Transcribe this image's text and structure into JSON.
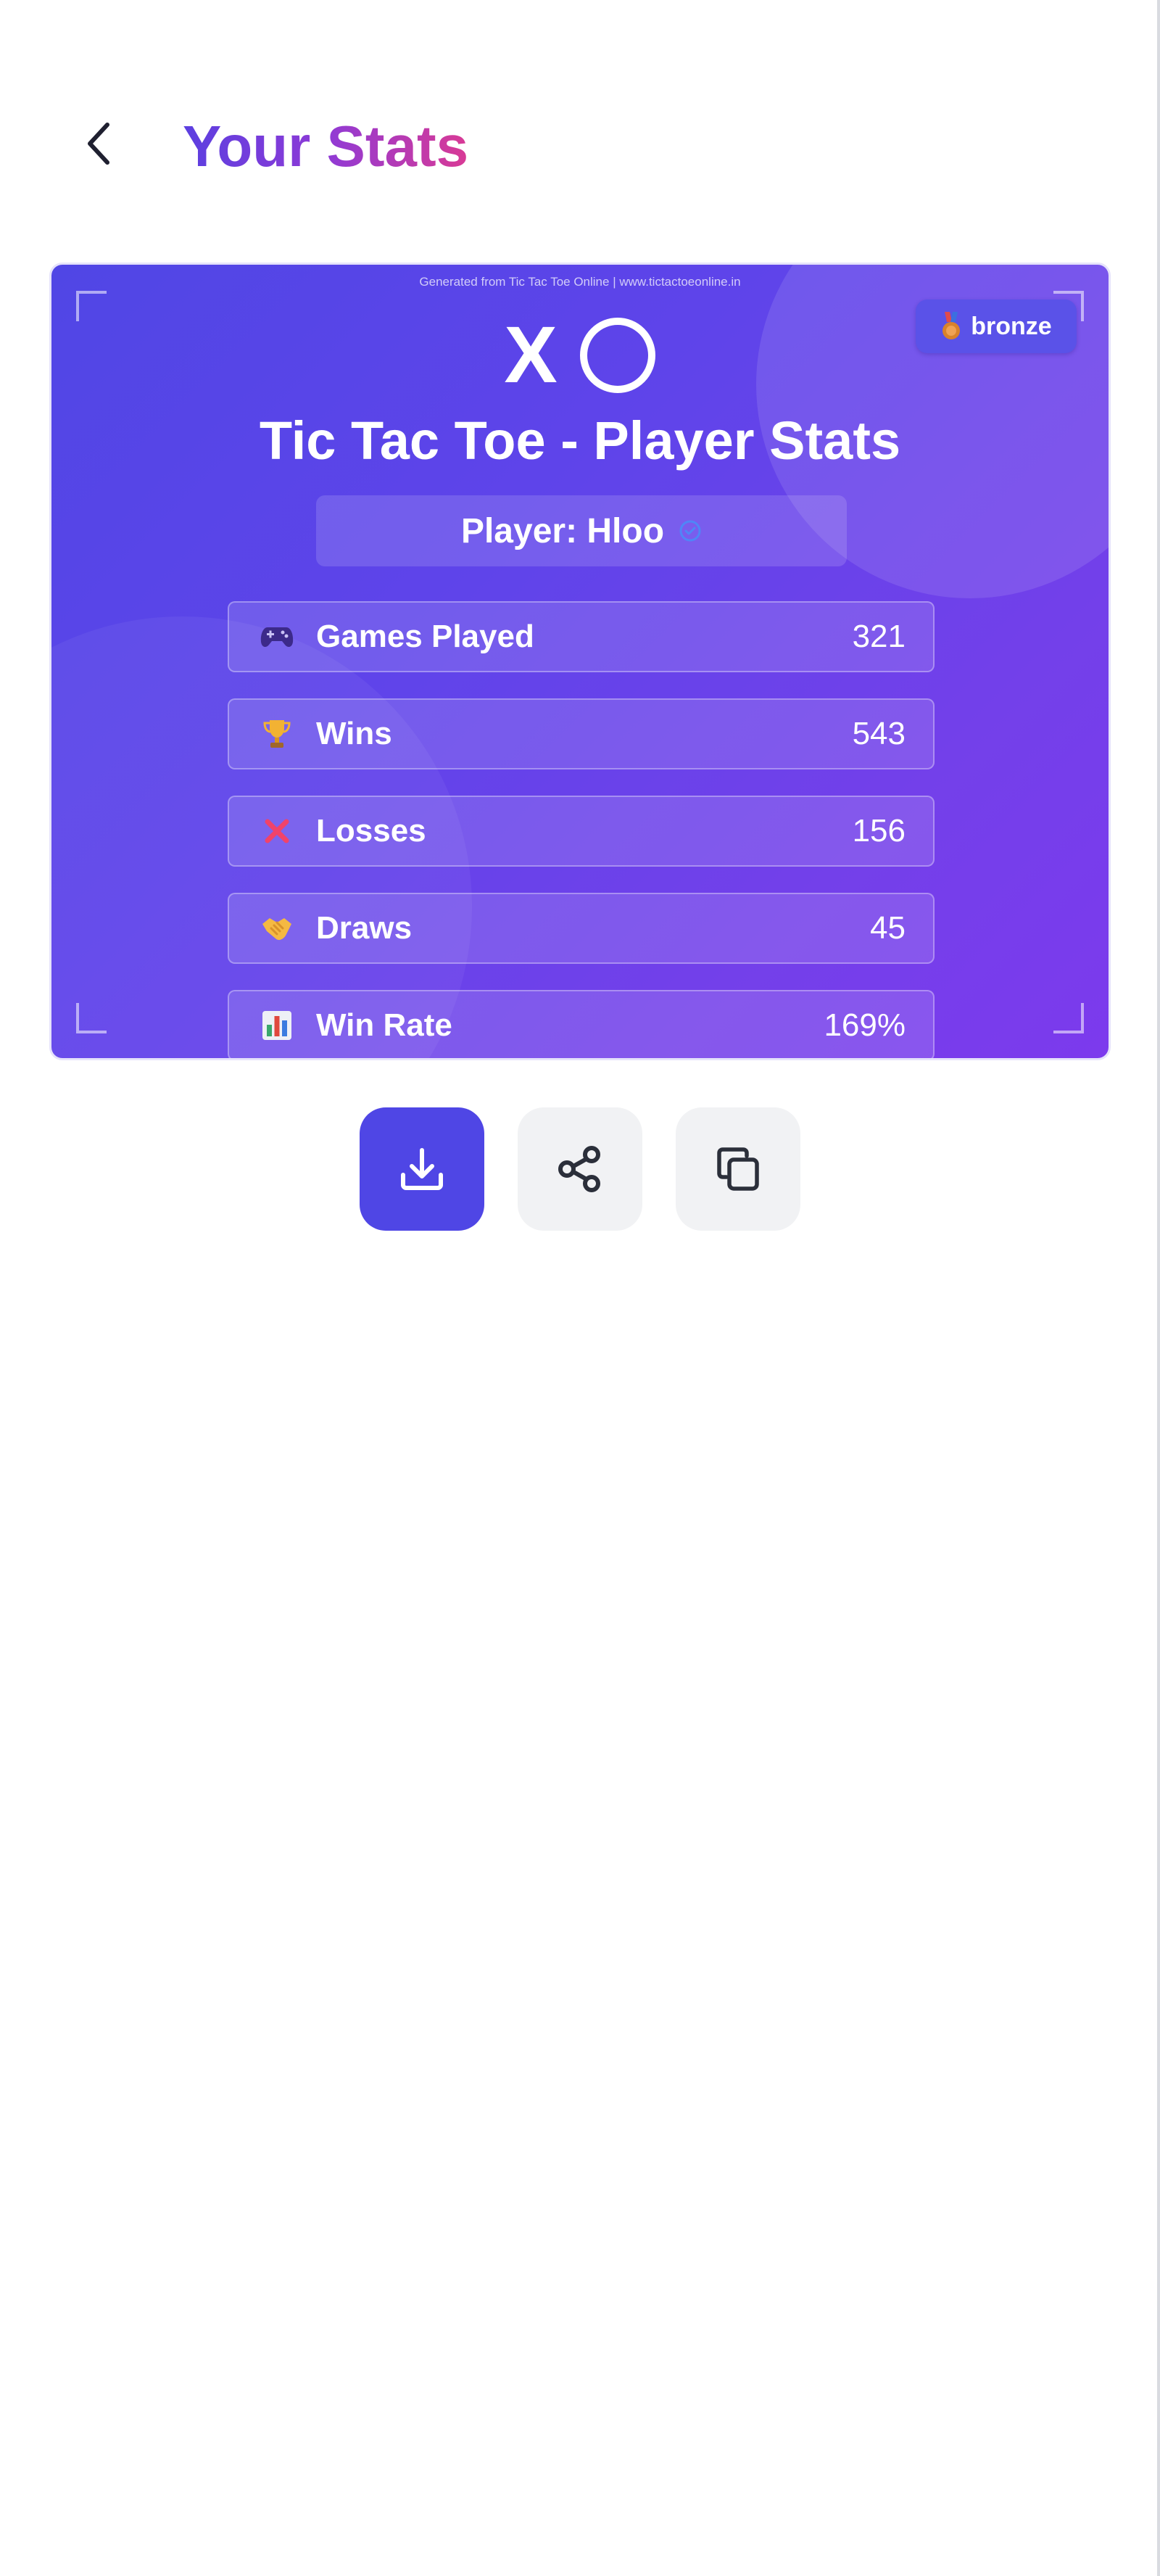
{
  "header": {
    "title": "Your Stats"
  },
  "card": {
    "source_note": "Generated from Tic Tac Toe Online | www.tictactoeonline.in",
    "badge": {
      "emoji": "🥉",
      "label": "bronze"
    },
    "logo_x": "X",
    "title": "Tic Tac Toe - Player Stats",
    "player": "Player: Hloo",
    "stats": [
      {
        "icon": "game-controller-icon",
        "label": "Games Played",
        "value": "321"
      },
      {
        "icon": "trophy-icon",
        "label": "Wins",
        "value": "543"
      },
      {
        "icon": "cross-mark-icon",
        "label": "Losses",
        "value": "156"
      },
      {
        "icon": "handshake-icon",
        "label": "Draws",
        "value": "45"
      },
      {
        "icon": "bar-chart-icon",
        "label": "Win Rate",
        "value": "169%"
      }
    ]
  },
  "actions": [
    {
      "icon": "download-icon"
    },
    {
      "icon": "share-icon"
    },
    {
      "icon": "copy-icon"
    }
  ],
  "colors": {
    "title_gradient": [
      "#5b3fe0",
      "#8f3ad6",
      "#d93a95"
    ],
    "card_gradient": [
      "#5046e5",
      "#7c3aed"
    ],
    "primary_button": "#4f46e5",
    "secondary_button": "#f1f2f4",
    "verified_accent": "#4f86f7"
  }
}
